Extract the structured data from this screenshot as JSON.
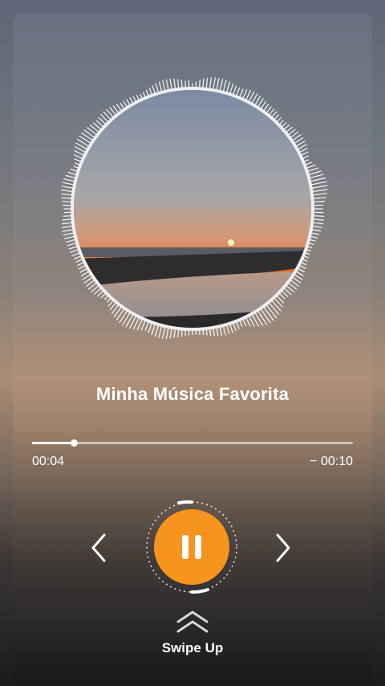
{
  "player": {
    "song_title": "Minha Música Favorita",
    "elapsed": "00:04",
    "remaining": "− 00:10",
    "progress_fraction": 0.13,
    "state": "playing"
  },
  "controls": {
    "prev_icon": "chevron-left-icon",
    "play_pause_icon": "pause-icon",
    "next_icon": "chevron-right-icon"
  },
  "footer": {
    "swipe_label": "Swipe Up",
    "swipe_icon": "double-chevron-up-icon"
  },
  "colors": {
    "accent": "#f7941d",
    "text": "#ffffff"
  }
}
